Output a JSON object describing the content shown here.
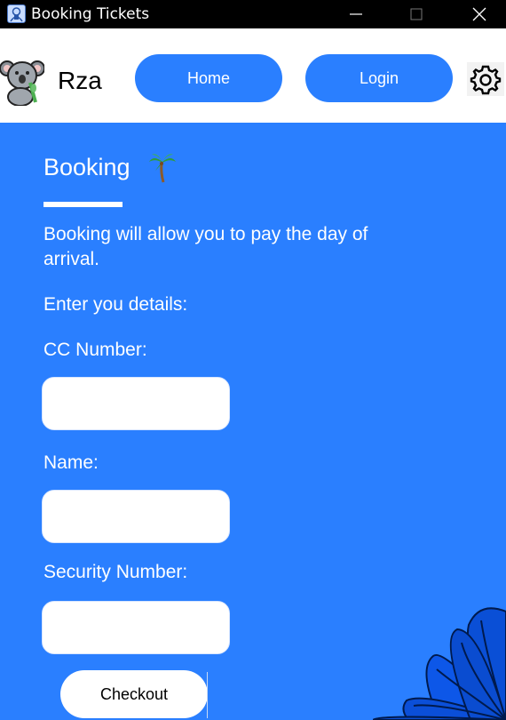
{
  "window": {
    "title": "Booking Tickets",
    "icons": [
      "app-icon",
      "minimize-icon",
      "maximize-icon",
      "close-icon"
    ]
  },
  "header": {
    "logo_icon": "koala-icon",
    "brand": "Rza",
    "nav": {
      "home": "Home",
      "login": "Login"
    },
    "settings_icon": "gear-icon"
  },
  "main": {
    "heading": "Booking",
    "heading_icon": "palm-tree-icon",
    "intro": "Booking will allow you to pay the day of arrival.",
    "prompt": "Enter you details:",
    "fields": {
      "cc_label": "CC Number:",
      "cc_value": "",
      "name_label": "Name:",
      "name_value": "",
      "security_label": "Security Number:",
      "security_value": ""
    },
    "checkout_label": "Checkout",
    "decor_icon": "leaf-decoration-icon"
  },
  "colors": {
    "accent": "#2a7fff",
    "titlebar": "#000000",
    "header_bg": "#ffffff",
    "text_on_accent": "#ffffff"
  }
}
